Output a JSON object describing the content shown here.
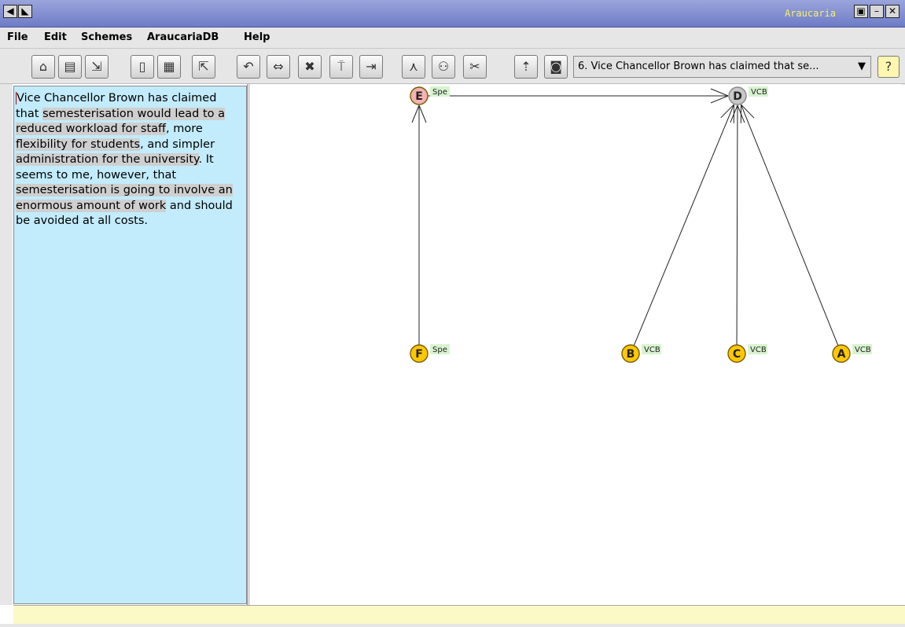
{
  "window": {
    "title": "Araucaria"
  },
  "menu": [
    "File",
    "Edit",
    "Schemes",
    "AraucariaDB",
    "Help"
  ],
  "toolbar": {
    "argument_select": "6. Vice Chancellor Brown has claimed that se...",
    "help_icon": "help-icon"
  },
  "text_panel": {
    "segments": [
      {
        "text": "Vice Chancellor Brown has claimed that ",
        "hl": false
      },
      {
        "text": "semesterisation would lead to a reduced workload for staff",
        "hl": true
      },
      {
        "text": ", more ",
        "hl": false
      },
      {
        "text": "flexibility for students",
        "hl": true
      },
      {
        "text": ", and simpler ",
        "hl": false
      },
      {
        "text": "administration for the university",
        "hl": true
      },
      {
        "text": ". It seems to me, however, that ",
        "hl": false
      },
      {
        "text": "semesterisation is going to involve an enormous amount of work",
        "hl": true
      },
      {
        "text": " and should be avoided at all costs.",
        "hl": false
      }
    ]
  },
  "diagram": {
    "nodes": [
      {
        "id": "E",
        "owner": "Spe",
        "kind": "pink"
      },
      {
        "id": "D",
        "owner": "VCB",
        "kind": "grey"
      },
      {
        "id": "F",
        "owner": "Spe",
        "kind": "yellow"
      },
      {
        "id": "B",
        "owner": "VCB",
        "kind": "yellow"
      },
      {
        "id": "C",
        "owner": "VCB",
        "kind": "yellow"
      },
      {
        "id": "A",
        "owner": "VCB",
        "kind": "yellow"
      }
    ],
    "edges": [
      {
        "from": "F",
        "to": "E"
      },
      {
        "from": "E",
        "to": "D"
      },
      {
        "from": "B",
        "to": "D"
      },
      {
        "from": "C",
        "to": "D"
      },
      {
        "from": "A",
        "to": "D"
      }
    ],
    "colors": {
      "pink": "#f4b2b2",
      "grey": "#c8c8c8",
      "yellow": "#ffc800",
      "owner_bg": "#d8f3cf"
    }
  },
  "status": {
    "text": ""
  }
}
